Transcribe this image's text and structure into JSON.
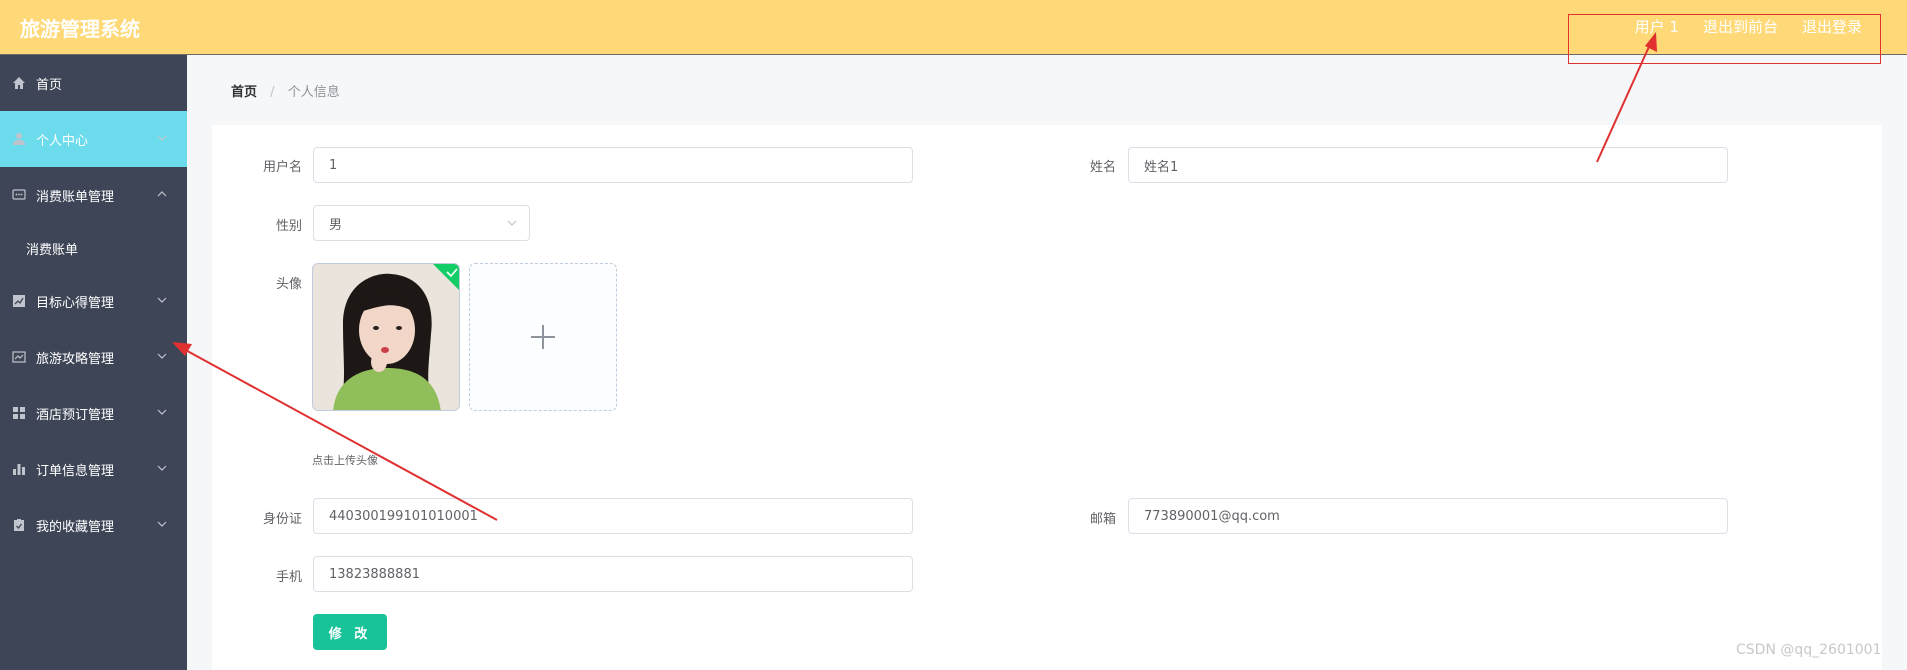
{
  "header": {
    "app_title": "旅游管理系统",
    "user_label": "用户 1",
    "to_front_label": "退出到前台",
    "logout_label": "退出登录",
    "background_color": "#ffd978"
  },
  "sidebar": {
    "items": [
      {
        "label": "首页",
        "icon": "home-icon"
      },
      {
        "label": "个人中心",
        "icon": "user-icon"
      },
      {
        "label": "消费账单管理",
        "icon": "chat-icon"
      },
      {
        "label": "消费账单"
      },
      {
        "label": "目标心得管理",
        "icon": "chart-icon"
      },
      {
        "label": "旅游攻略管理",
        "icon": "trend-icon"
      },
      {
        "label": "酒店预订管理",
        "icon": "grid-icon"
      },
      {
        "label": "订单信息管理",
        "icon": "bar-chart-icon"
      },
      {
        "label": "我的收藏管理",
        "icon": "clipboard-icon"
      }
    ],
    "background_color": "#3e4556",
    "active_color": "#6cdcec"
  },
  "breadcrumb": {
    "home": "首页",
    "separator": "/",
    "current": "个人信息"
  },
  "form": {
    "username_label": "用户名",
    "username_value": "1",
    "name_label": "姓名",
    "name_value": "姓名1",
    "gender_label": "性别",
    "gender_value": "男",
    "avatar_label": "头像",
    "upload_tip": "点击上传头像",
    "id_label": "身份证",
    "id_value": "440300199101010001",
    "email_label": "邮箱",
    "email_value": "773890001@qq.com",
    "phone_label": "手机",
    "phone_value": "13823888881",
    "submit_label": "修 改",
    "submit_color": "#19c39a"
  },
  "watermark": "CSDN @qq_2601001"
}
